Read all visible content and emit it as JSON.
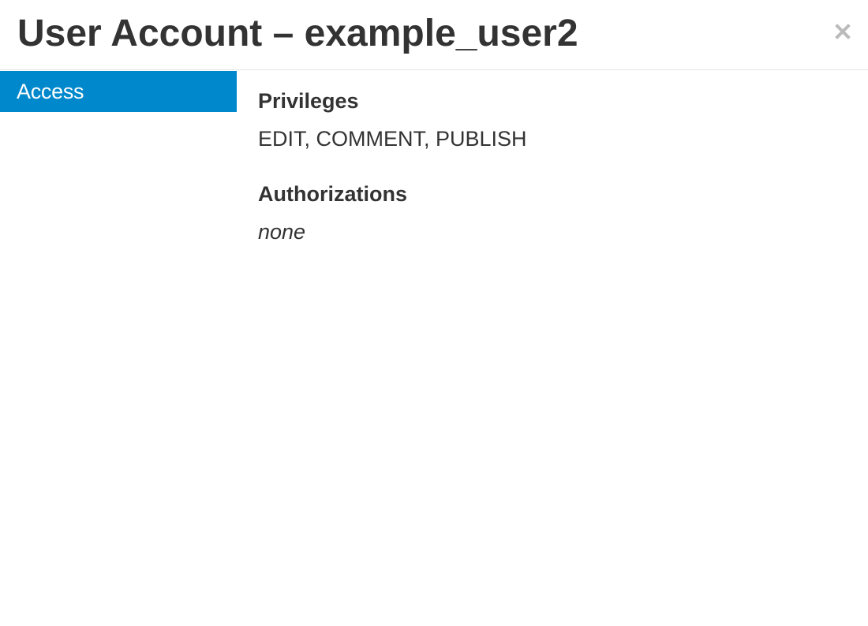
{
  "modal": {
    "title": "User Account – example_user2",
    "close_label": "×",
    "close_icon": "close-icon"
  },
  "sidebar": {
    "items": [
      {
        "label": "Access",
        "active": true
      }
    ]
  },
  "access": {
    "privileges_heading": "Privileges",
    "privileges_value": "EDIT, COMMENT, PUBLISH",
    "authorizations_heading": "Authorizations",
    "authorizations_value": "none"
  },
  "colors": {
    "active_tab_background": "#0088cc",
    "text": "#333333",
    "close_icon": "#bbbbbb",
    "divider": "#e5e5e5"
  }
}
